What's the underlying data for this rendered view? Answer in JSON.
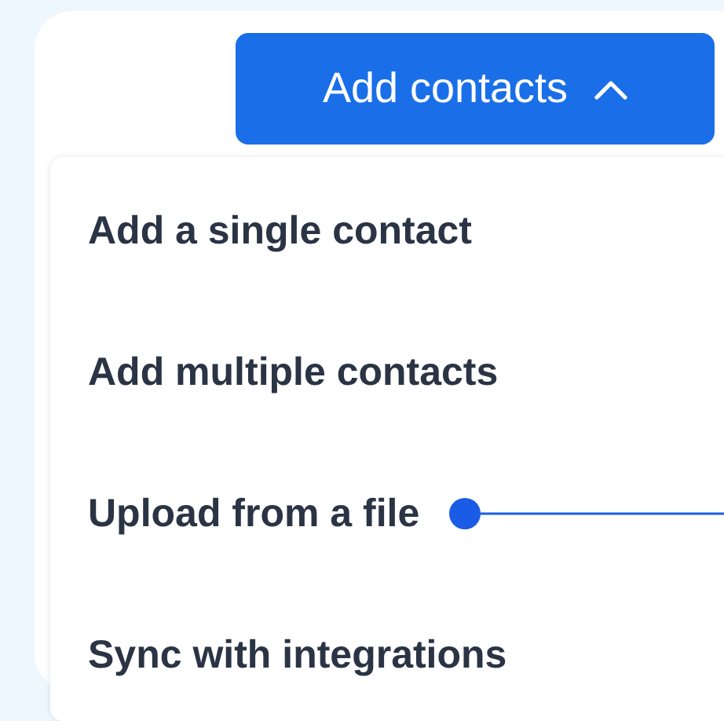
{
  "button": {
    "label": "Add contacts",
    "expanded": true
  },
  "menu": [
    {
      "label": "Add a single contact",
      "marked": false
    },
    {
      "label": "Add multiple contacts",
      "marked": false
    },
    {
      "label": "Upload from a file",
      "marked": true
    },
    {
      "label": "Sync with integrations",
      "marked": false
    }
  ]
}
